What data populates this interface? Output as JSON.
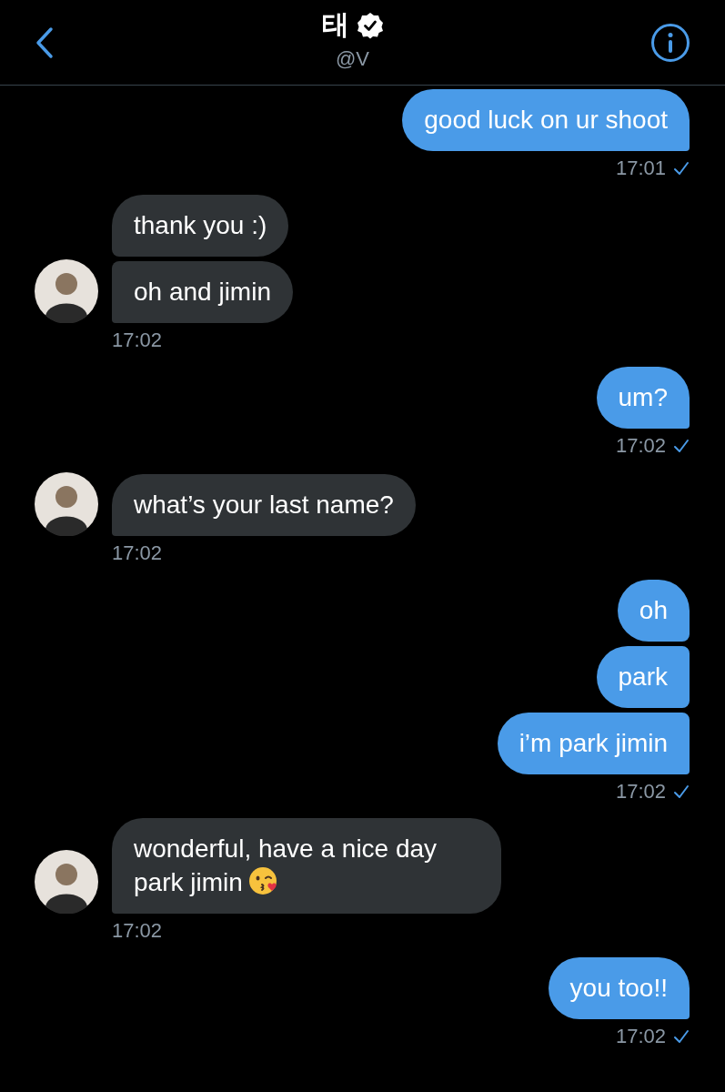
{
  "header": {
    "title": "태",
    "verified": true,
    "handle": "@V"
  },
  "groups": [
    {
      "kind": "sent",
      "messages": [
        "good luck on ur shoot"
      ],
      "time": "17:01",
      "read": true
    },
    {
      "kind": "received",
      "messages": [
        "thank you :)",
        "oh and jimin"
      ],
      "time": "17:02"
    },
    {
      "kind": "sent",
      "messages": [
        "um?"
      ],
      "time": "17:02",
      "read": true
    },
    {
      "kind": "received",
      "messages": [
        "what’s your last name?"
      ],
      "time": "17:02"
    },
    {
      "kind": "sent",
      "messages": [
        "oh",
        "park",
        "i’m park jimin"
      ],
      "time": "17:02",
      "read": true
    },
    {
      "kind": "received",
      "messages": [
        "wonderful, have a nice day park jimin"
      ],
      "emoji": true,
      "time": "17:02"
    },
    {
      "kind": "sent",
      "messages": [
        "you too!!"
      ],
      "time": "17:02",
      "read": true
    }
  ]
}
